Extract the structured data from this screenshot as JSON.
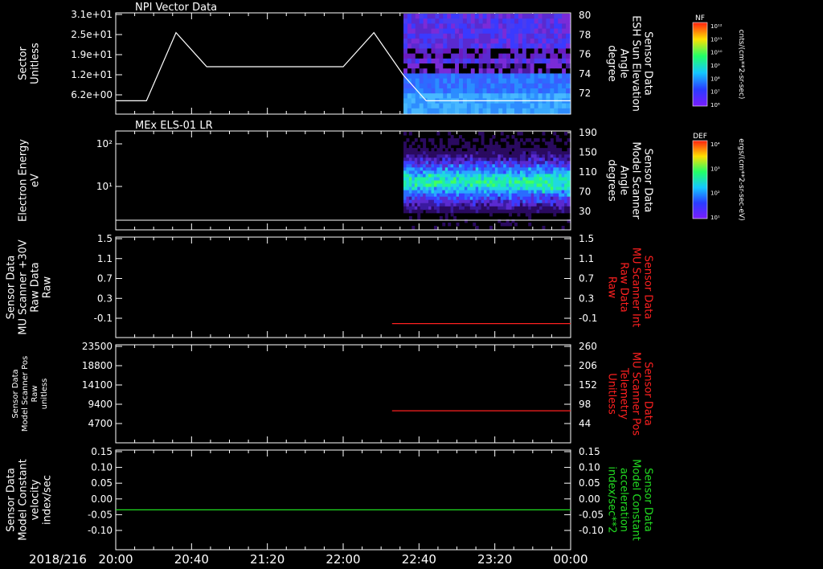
{
  "colors": {
    "axis": "#ffffff",
    "red": "#ff2020",
    "green": "#22dd22",
    "bg": "#000000"
  },
  "chart_data": [
    {
      "type": "line",
      "title": "NPI Vector Data",
      "ylabel_left": [
        "Sector",
        "Unitless"
      ],
      "yticks_left": [
        "3.1e+01",
        "2.5e+01",
        "1.9e+01",
        "1.2e+01",
        "6.2e+00"
      ],
      "ylabel_right": [
        "Sensor Data",
        "ESH Sun Elevation",
        "Angle",
        "degree"
      ],
      "yticks_right": [
        "80",
        "78",
        "76",
        "74",
        "72"
      ],
      "x_hours": [
        0,
        0.27,
        0.53,
        0.8,
        1.0,
        2.0,
        2.27,
        2.53,
        2.73,
        2.8,
        4.0
      ],
      "y": [
        0.3,
        0.3,
        2.7,
        1.5,
        1.5,
        1.5,
        2.7,
        1.2,
        0.3,
        0.3,
        0.3
      ],
      "spectrogram": {
        "start_hour": 2.53,
        "end_hour": 4.0,
        "label": "NF",
        "cbar_ticks": [
          "10¹²",
          "10¹¹",
          "10¹⁰",
          "10⁹",
          "10⁸",
          "10⁷",
          "10⁶"
        ],
        "cbar_unit": "cnts/(cm**2-sr-sec)"
      }
    },
    {
      "type": "heatmap",
      "title": "MEx ELS-01 LR",
      "ylabel_left": [
        "Electron Energy",
        "eV"
      ],
      "yticks_left": [
        "10²",
        "10¹"
      ],
      "ylabel_right": [
        "Sensor Data",
        "Model Scanner",
        "Angle",
        "degrees"
      ],
      "yticks_right": [
        "190",
        "150",
        "110",
        "70",
        "30"
      ],
      "spectrogram": {
        "start_hour": 2.53,
        "end_hour": 4.0,
        "label": "DEF",
        "cbar_ticks": [
          "10⁴",
          "10³",
          "10²",
          "10¹"
        ],
        "cbar_unit": "ergs/(cm**2-sr-sec-eV)"
      }
    },
    {
      "type": "line",
      "ylabel_left": [
        "Sensor Data",
        "MU Scanner +30V",
        "Raw Data",
        "Raw"
      ],
      "yticks_left": [
        "1.5",
        "1.1",
        "0.7",
        "0.3",
        "-0.1"
      ],
      "ylabel_right": [
        "Sensor Data",
        "MU Scanner Int",
        "Raw Data",
        "Raw"
      ],
      "yticks_right": [
        "1.5",
        "1.1",
        "0.7",
        "0.3",
        "-0.1"
      ],
      "ylim": [
        -0.3,
        1.5
      ],
      "series": [
        {
          "x_hours": [
            2.43,
            4.0
          ],
          "y": [
            -0.05,
            -0.05
          ],
          "color": "#ff2020"
        }
      ]
    },
    {
      "type": "line",
      "ylabel_left": [
        "Sensor Data",
        "Model Scanner Pos",
        "Raw",
        "unitless"
      ],
      "yticks_left": [
        "23500",
        "18800",
        "14100",
        "9400",
        "4700"
      ],
      "ylabel_right": [
        "Sensor Data",
        "MU Scanner Pos",
        "Telemetry",
        "Unitless"
      ],
      "yticks_right": [
        "260",
        "206",
        "152",
        "98",
        "44"
      ],
      "ylim": [
        0,
        260
      ],
      "series": [
        {
          "x_hours": [
            2.43,
            4.0
          ],
          "y": [
            85,
            85
          ],
          "color": "#ff2020"
        }
      ]
    },
    {
      "type": "line",
      "ylabel_left": [
        "Sensor Data",
        "Model Constant",
        "velocity",
        "index/sec"
      ],
      "yticks_left": [
        "0.15",
        "0.10",
        "0.05",
        "0.00",
        "-0.05",
        "-0.10"
      ],
      "ylabel_right": [
        "Sensor Data",
        "Model Constant",
        "acceleration",
        "index/sec**2"
      ],
      "yticks_right": [
        "0.15",
        "0.10",
        "0.05",
        "0.00",
        "-0.05",
        "-0.10"
      ],
      "ylim": [
        -0.1,
        0.15
      ],
      "series": [
        {
          "x_hours": [
            0,
            4.0
          ],
          "y": [
            0.0,
            0.0
          ],
          "color": "#22dd22"
        }
      ]
    }
  ],
  "xaxis": {
    "date": "2018/216",
    "ticks": [
      "20:00",
      "20:40",
      "21:20",
      "22:00",
      "22:40",
      "23:20",
      "00:00"
    ],
    "tick_hours": [
      0,
      0.6667,
      1.3333,
      2.0,
      2.6667,
      3.3333,
      4.0
    ]
  }
}
